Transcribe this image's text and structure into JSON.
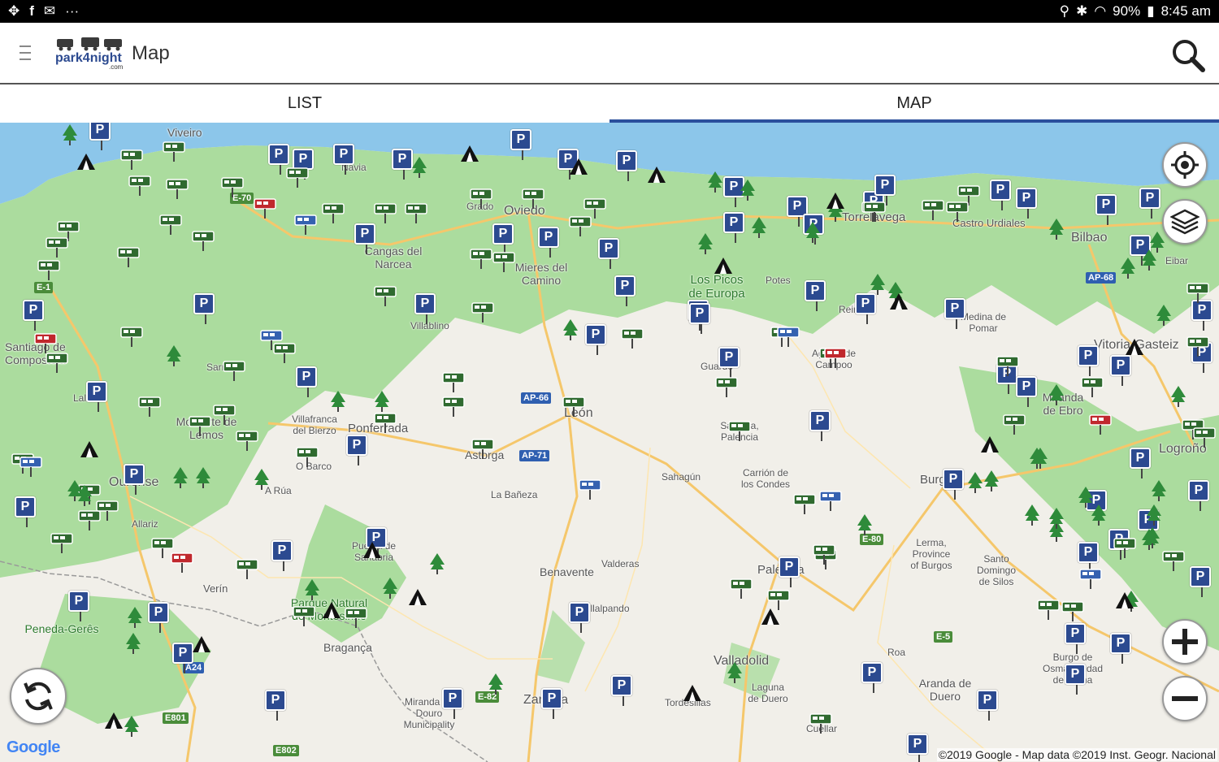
{
  "status_bar": {
    "battery": "90%",
    "time": "8:45 am",
    "more": "···"
  },
  "app_bar": {
    "title": "Map",
    "logo_text": "park4night",
    "logo_sub": ".com"
  },
  "tabs": [
    {
      "label": "LIST"
    },
    {
      "label": "MAP"
    }
  ],
  "map": {
    "places": [
      "Viveiro",
      "Oviedo",
      "Grado",
      "Cangas del Narcea",
      "Mieres del Camino",
      "Villablino",
      "Santiago de Compostela",
      "Lalín",
      "Monforte de Lemos",
      "Sarria",
      "Ponferrada",
      "Villafranca del Bierzo",
      "O Barco",
      "A Rúa",
      "Ourense",
      "Allariz",
      "Verín",
      "Puebla de Sanabria",
      "Bragança",
      "Miranda do Douro Municipality",
      "Zamora",
      "Benavente",
      "La Bañeza",
      "Astorga",
      "León",
      "Sahagún",
      "Carrión de los Condes",
      "Valderas",
      "Villalpando",
      "Palencia",
      "Valladolid",
      "Laguna de Duero",
      "Tordesillas",
      "Cuéllar",
      "Aranda de Duero",
      "Roa",
      "Burgos",
      "Lerma, Province of Burgos",
      "Santo Domingo de Silos",
      "Burgo de Osma-Ciudad de Osma",
      "Logroño",
      "Miranda de Ebro",
      "Vitoria-Gasteiz",
      "Medina de Pomar",
      "Reinosa",
      "Aguilar de Campoo",
      "Guardo",
      "Saldaña, Palencia",
      "Torrelavega",
      "Castro Urdiales",
      "Bilbao",
      "Eibar",
      "Los Picos de Europa",
      "Potes",
      "Parque Natural de Montesinho",
      "Peneda-Gerês",
      "Navia"
    ],
    "roads": [
      "E-70",
      "E-1",
      "AP-66",
      "AP-71",
      "E-80",
      "E-5",
      "A24",
      "E801",
      "E802",
      "E-82",
      "AP-68"
    ]
  },
  "controls": {
    "locate": "locate-icon",
    "layers": "layers-icon",
    "zoom_in": "plus-icon",
    "zoom_out": "minus-icon",
    "refresh": "refresh-icon"
  },
  "attribution": {
    "logo": "Google",
    "copyright": "©2019 Google - Map data ©2019 Inst. Geogr. Nacional"
  },
  "colors": {
    "accent": "#2b4f9c",
    "parking_pin": "#2c4a90",
    "camper_pin": "#3f5d3f",
    "land": "#abdc9e",
    "sea": "#8cc6ea"
  }
}
